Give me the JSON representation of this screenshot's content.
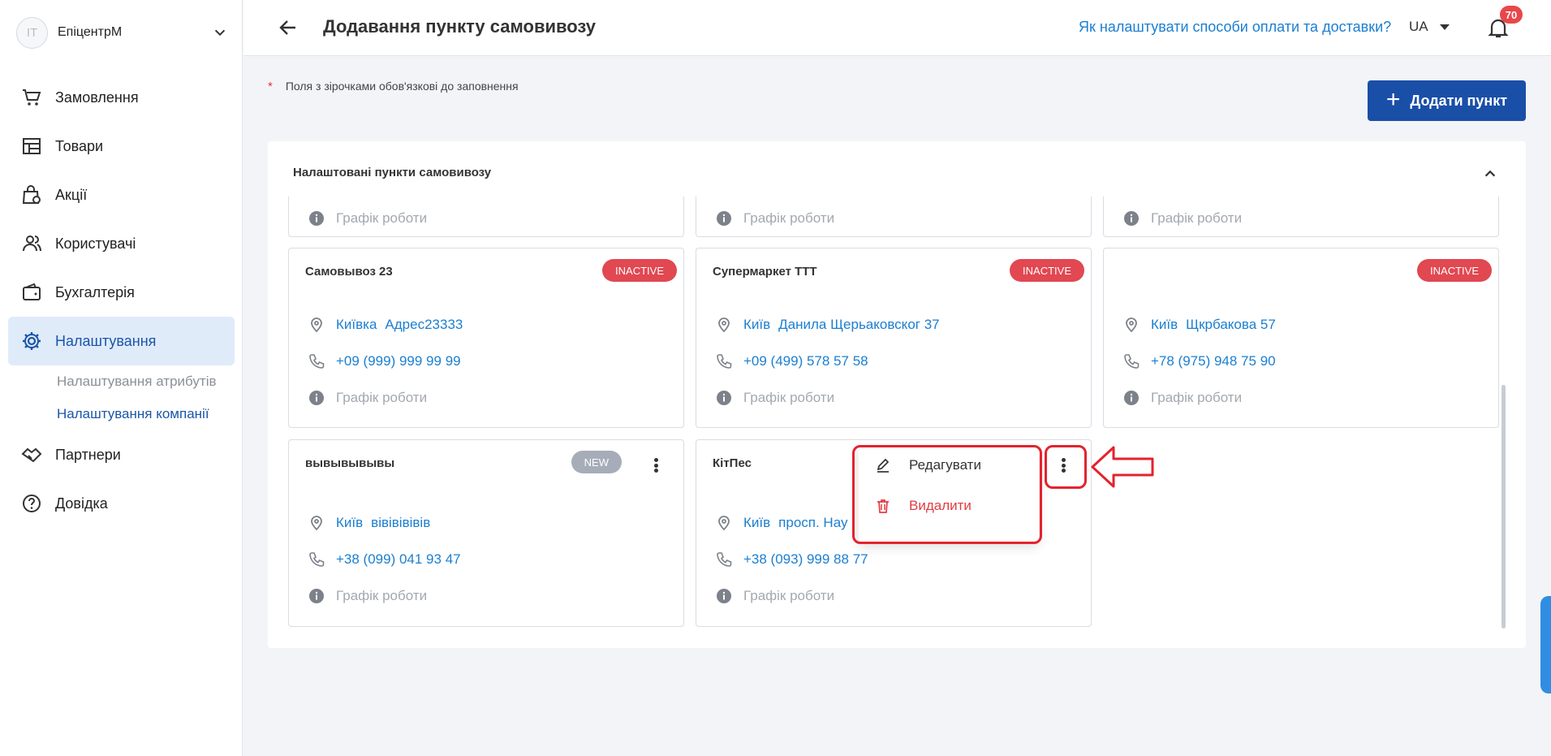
{
  "sidebar": {
    "avatar_initials": "IT",
    "company_name": "ЕпіцентрМ",
    "nav": [
      {
        "label": "Замовлення",
        "icon": "cart-icon"
      },
      {
        "label": "Товари",
        "icon": "store-icon"
      },
      {
        "label": "Акції",
        "icon": "promo-bag-icon"
      },
      {
        "label": "Користувачі",
        "icon": "users-icon"
      },
      {
        "label": "Бухгалтерія",
        "icon": "wallet-icon"
      },
      {
        "label": "Налаштування",
        "icon": "gear-icon"
      },
      {
        "label": "Партнери",
        "icon": "handshake-icon"
      },
      {
        "label": "Довідка",
        "icon": "help-circle-icon"
      }
    ],
    "sub_items": [
      "Налаштування атрибутів",
      "Налаштування компанії"
    ]
  },
  "header": {
    "title": "Додавання пункту самовивозу",
    "help_link": "Як налаштувати способи оплати та доставки?",
    "language": "UA",
    "notifications_count": "70"
  },
  "content": {
    "required_star": "*",
    "required_note": "Поля з зірочками обов'язкові до заповнення",
    "add_button": "Додати пункт",
    "panel_title": "Налаштовані пункти самовивозу",
    "schedule_label": "Графік роботи",
    "cards": [
      {
        "name": "Самовывоз 23",
        "status": "INACTIVE",
        "city": "Київка",
        "address": "Адрес23333",
        "phone": "+09 (999) 999 99 99"
      },
      {
        "name": "Супермаркет ТТТ",
        "status": "INACTIVE",
        "city": "Київ",
        "address": "Данила Щерьаковског 37",
        "phone": "+09 (499) 578 57 58"
      },
      {
        "name": "",
        "status": "INACTIVE",
        "city": "Київ",
        "address": "Щкрбакова 57",
        "phone": "+78 (975) 948 75 90"
      },
      {
        "name": "вывывывывы",
        "status": "NEW",
        "city": "Київ",
        "address": "вівівівівів",
        "phone": "+38 (099) 041 93 47"
      },
      {
        "name": "КітПес",
        "status": "",
        "city": "Київ",
        "address": "просп. Нау",
        "phone": "+38 (093) 999 88 77"
      }
    ]
  },
  "popup_menu": {
    "edit": "Редагувати",
    "delete": "Видалити"
  },
  "colors": {
    "primary": "#1a4fa8",
    "link": "#1b7fd1",
    "inactive": "#e14851",
    "new": "#a6adb8",
    "annotation": "#e3232e"
  }
}
